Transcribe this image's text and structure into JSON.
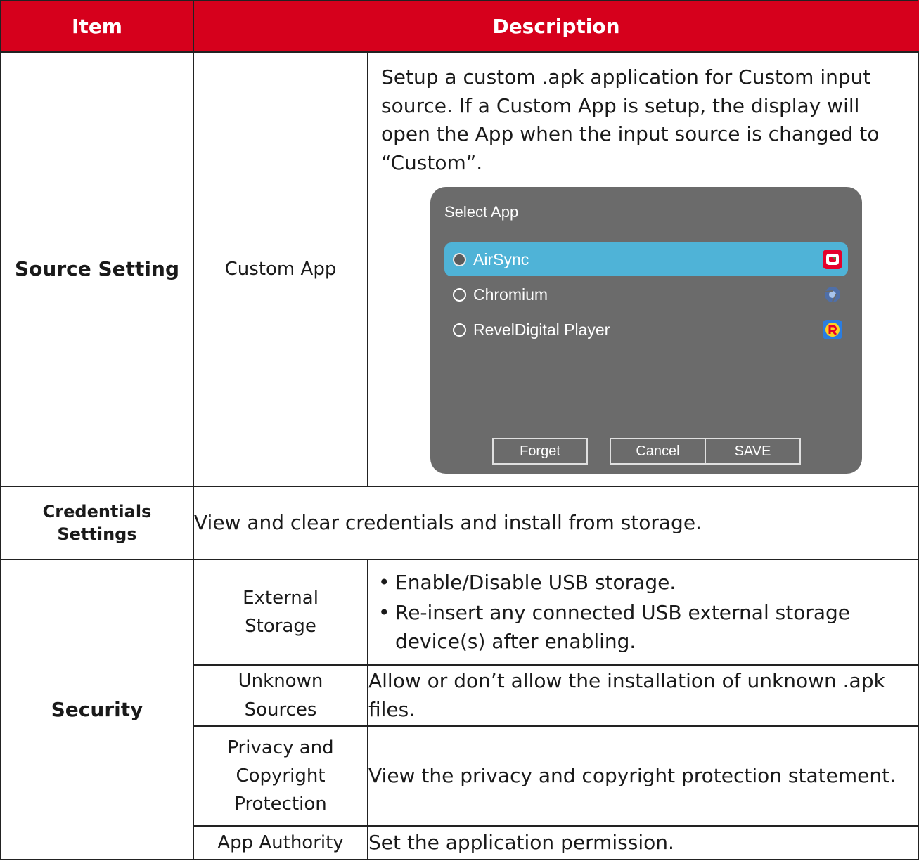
{
  "header": {
    "item": "Item",
    "description": "Description"
  },
  "rows": {
    "source_setting": {
      "item": "Source Setting",
      "sub": "Custom App",
      "description": "Setup a custom .apk application for Custom input source. If a Custom App is setup, the display will open the App when the input source is changed to “Custom”.",
      "dialog": {
        "title": "Select App",
        "options": [
          "AirSync",
          "Chromium",
          "RevelDigital Player"
        ],
        "selected_option": "AirSync",
        "buttons": {
          "forget": "Forget",
          "cancel": "Cancel",
          "save": "SAVE"
        },
        "icons": [
          "airsync-icon",
          "chromium-icon",
          "reveldigital-icon"
        ],
        "colors": {
          "background": "#6b6b6b",
          "selected": "#4fb3d7"
        }
      }
    },
    "credentials": {
      "item_line1": "Credentials",
      "item_line2": "Settings",
      "description": "View and clear credentials and install from storage."
    },
    "security": {
      "item": "Security",
      "external_storage": {
        "sub_line1": "External",
        "sub_line2": "Storage",
        "bullets": [
          "Enable/Disable USB storage.",
          "Re-insert any connected USB external storage device(s) after enabling."
        ]
      },
      "unknown_sources": {
        "sub_line1": "Unknown",
        "sub_line2": "Sources",
        "description": "Allow or don’t allow the installation of unknown .apk files."
      },
      "privacy": {
        "sub_line1": "Privacy and",
        "sub_line2": "Copyright",
        "sub_line3": "Protection",
        "description": "View the privacy and copyright protection statement."
      },
      "app_authority": {
        "sub": "App Authority",
        "description": "Set the application permission."
      }
    }
  },
  "colors": {
    "header_red": "#d6001c"
  }
}
